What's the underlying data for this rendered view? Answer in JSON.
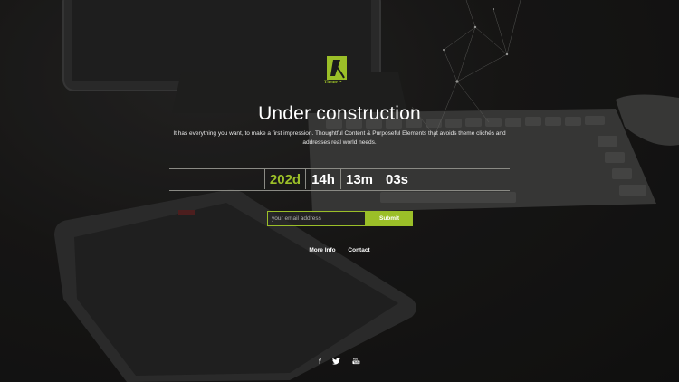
{
  "brand": {
    "logo_text": "Theme",
    "logo_marks": "••",
    "accent": "#9bbf28"
  },
  "hero": {
    "title": "Under construction",
    "description": "It has everything you want, to make a first impression. Thoughtful Content & Purposeful Elements that avoids theme clichés and addresses real world needs."
  },
  "countdown": {
    "days": "202d",
    "hours": "14h",
    "minutes": "13m",
    "seconds": "03s"
  },
  "subscribe": {
    "placeholder": "your email address",
    "button_label": "Submit"
  },
  "nav": {
    "more_info": "More Info",
    "contact": "Contact"
  },
  "social": {
    "facebook_icon": "f",
    "twitter_icon": "🐦",
    "youtube_icon": "▶"
  }
}
